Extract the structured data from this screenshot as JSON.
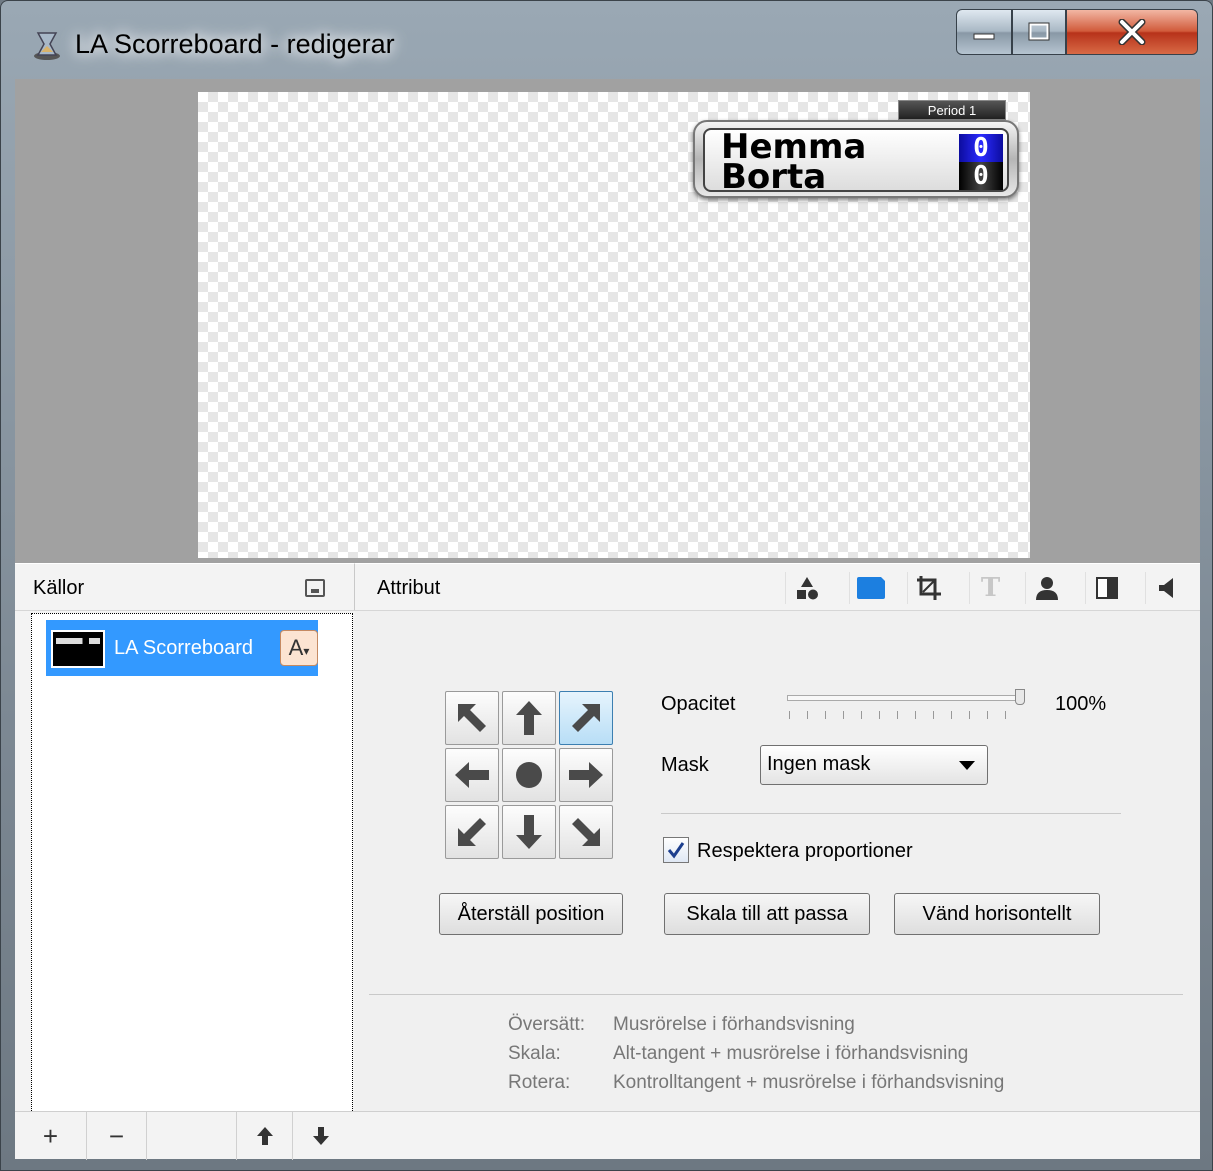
{
  "window": {
    "title": "LA Scorreboard - redigerar",
    "controls": {
      "minimize": "minimize-icon",
      "maximize": "maximize-icon",
      "close": "close-icon"
    }
  },
  "preview": {
    "scoreboard": {
      "period": "Period 1",
      "home_team": "Hemma",
      "away_team": "Borta",
      "home_score": "0",
      "away_score": "0"
    }
  },
  "sources": {
    "header": "Källor",
    "items": [
      {
        "label": "LA Scorreboard",
        "type_badge": "A"
      }
    ],
    "toolbar": {
      "add": "+",
      "remove": "−",
      "move_up": "up-arrow-icon",
      "move_down": "down-arrow-icon"
    }
  },
  "attributes": {
    "header": "Attribut",
    "tabs": [
      "shapes-icon",
      "position-icon",
      "crop-icon",
      "text-icon",
      "person-icon",
      "contrast-icon",
      "audio-icon"
    ],
    "opacity_label": "Opacitet",
    "opacity_value": "100%",
    "opacity_level": 1.0,
    "mask_label": "Mask",
    "mask_value": "Ingen mask",
    "keep_aspect_label": "Respektera proportioner",
    "keep_aspect_checked": true,
    "buttons": {
      "reset_position": "Återställ position",
      "scale_to_fit": "Skala till att passa",
      "flip_horizontal": "Vänd horisontellt"
    },
    "hints": [
      {
        "key": "Översätt:",
        "text": "Musrörelse i förhandsvisning"
      },
      {
        "key": "Skala:",
        "text": "Alt-tangent + musrörelse i förhandsvisning"
      },
      {
        "key": "Rotera:",
        "text": "Kontrolltangent + musrörelse i förhandsvisning"
      }
    ]
  },
  "colors": {
    "selection": "#3399ff",
    "home_score_bg": "#1a1acc",
    "close_button": "#c8432a"
  }
}
